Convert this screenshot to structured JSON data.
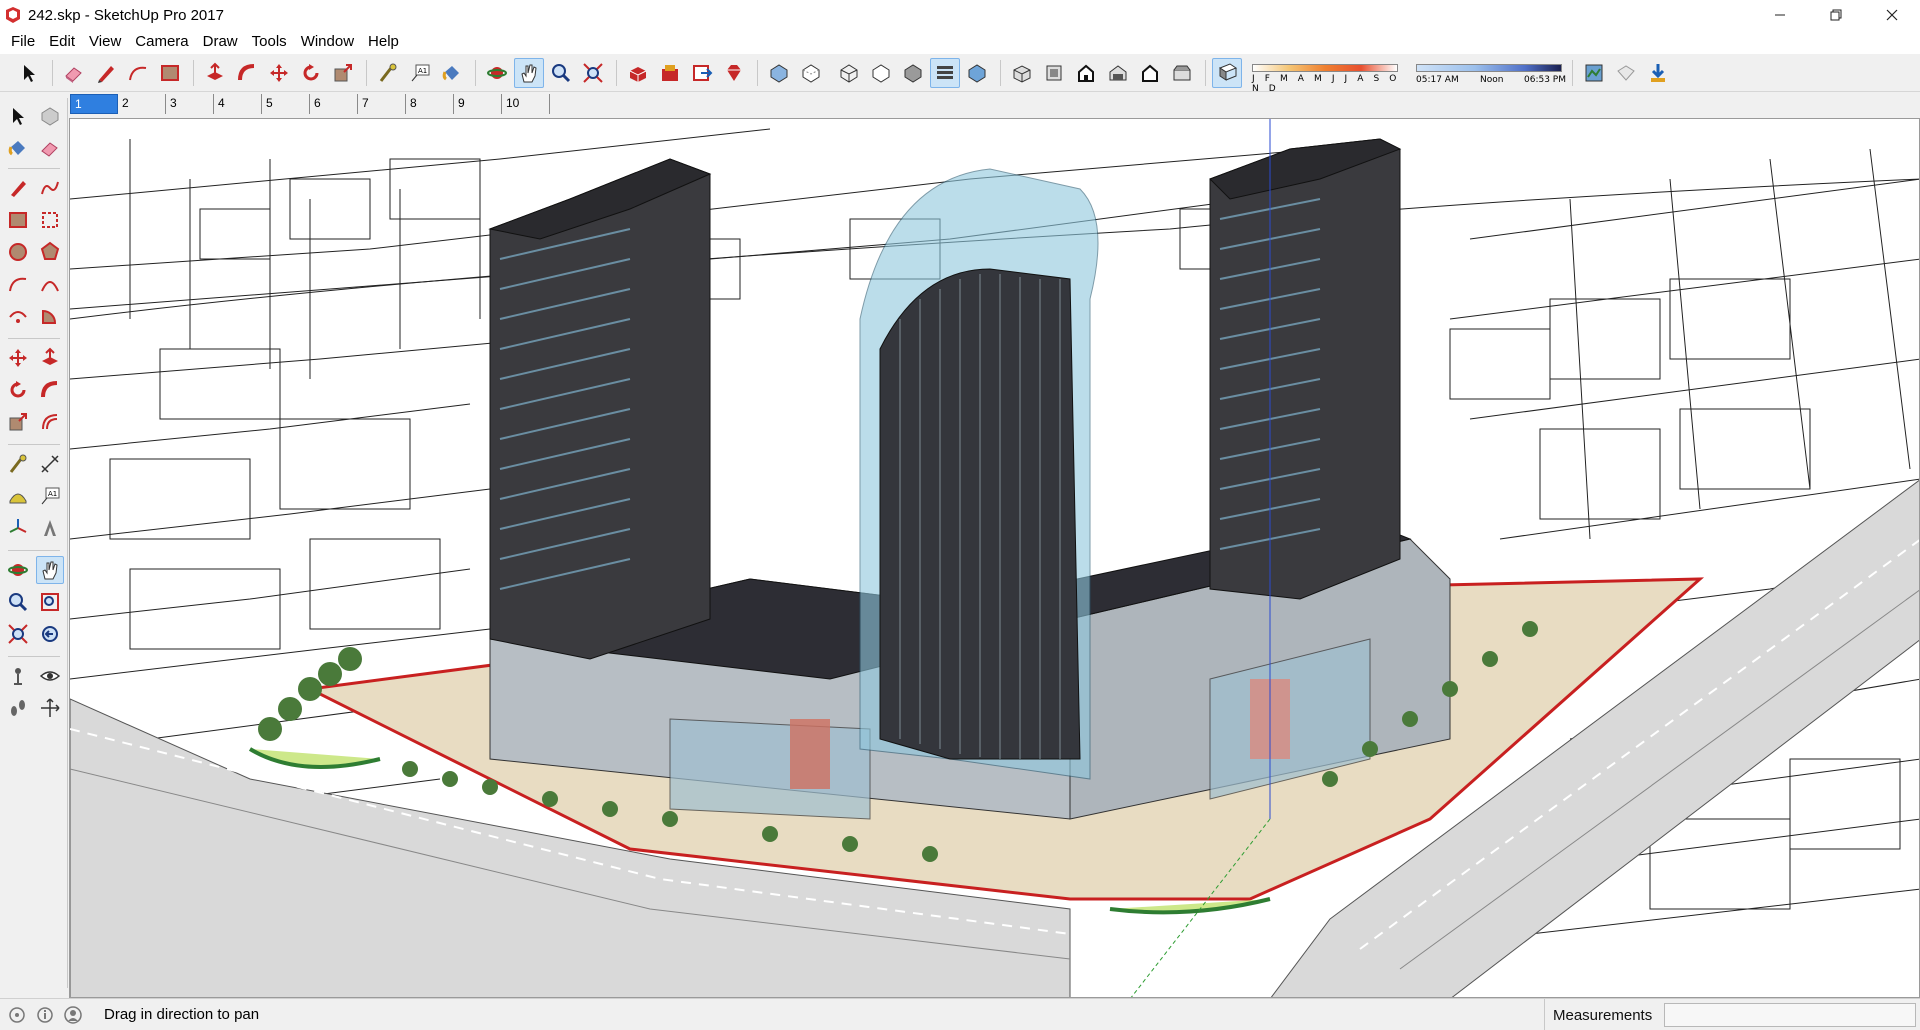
{
  "window": {
    "title": "242.skp - SketchUp Pro 2017",
    "controls": [
      "minimize",
      "maximize",
      "close"
    ]
  },
  "menu": [
    "File",
    "Edit",
    "View",
    "Camera",
    "Draw",
    "Tools",
    "Window",
    "Help"
  ],
  "toolbar": {
    "groups": [
      [
        "select-icon",
        "eraser-icon",
        "pencil-icon",
        "arc-icon",
        "rectangle-icon"
      ],
      [
        "push-pull-icon",
        "follow-me-icon",
        "move-icon",
        "rotate-icon",
        "scale-icon"
      ],
      [
        "tape-measure-icon",
        "text-icon",
        "paint-bucket-icon"
      ],
      [
        "orbit-icon",
        "pan-icon",
        "zoom-icon",
        "zoom-extents-icon"
      ],
      [
        "3d-warehouse-icon",
        "extension-warehouse-icon",
        "send-to-layout-icon",
        "ruby-console-icon"
      ],
      [
        "xray-style-icon",
        "back-edges-style-icon",
        "wireframe-style-icon",
        "hidden-line-style-icon",
        "shaded-style-icon",
        "shaded-textures-style-icon",
        "monochrome-style-icon"
      ],
      [
        "iso-view-icon",
        "top-view-icon",
        "front-view-icon",
        "right-view-icon",
        "back-view-icon",
        "left-view-icon"
      ],
      [
        "shadow-toggle-icon"
      ],
      [
        "layer-manager-icon",
        "tag-icon",
        "import-icon"
      ]
    ],
    "active_tool": "pan-icon",
    "shadow": {
      "months": "J F M A M J J A S O N D",
      "time_start": "05:17 AM",
      "time_mid": "Noon",
      "time_end": "06:53 PM"
    }
  },
  "scenes": [
    "1",
    "2",
    "3",
    "4",
    "5",
    "6",
    "7",
    "8",
    "9",
    "10"
  ],
  "active_scene": "1",
  "left_toolbar": [
    [
      "select-icon",
      "component-icon"
    ],
    [
      "paint-bucket-icon",
      "eraser-icon"
    ],
    [
      "line-icon",
      "freehand-icon"
    ],
    [
      "rectangle-icon",
      "rotated-rectangle-icon"
    ],
    [
      "circle-icon",
      "polygon-icon"
    ],
    [
      "arc-icon",
      "two-point-arc-icon"
    ],
    [
      "three-point-arc-icon",
      "pie-icon"
    ],
    [
      "move-icon",
      "push-pull-icon"
    ],
    [
      "rotate-icon",
      "follow-me-icon"
    ],
    [
      "scale-icon",
      "offset-icon"
    ],
    [
      "tape-measure-icon",
      "dimension-icon"
    ],
    [
      "protractor-icon",
      "text-icon"
    ],
    [
      "axes-icon",
      "3d-text-icon"
    ],
    [
      "orbit-icon",
      "pan-icon"
    ],
    [
      "zoom-icon",
      "zoom-window-icon"
    ],
    [
      "zoom-extents-icon",
      "previous-view-icon"
    ],
    [
      "position-camera-icon",
      "look-around-icon"
    ],
    [
      "walk-icon",
      "section-plane-icon"
    ]
  ],
  "status": {
    "message": "Drag in direction to pan",
    "measurements_label": "Measurements",
    "measurements_value": ""
  },
  "colors": {
    "selection_blue": "#2f7fe0",
    "tower_dark": "#3a3a3e",
    "glass": "#8ec7dd",
    "site_boundary": "#c82020"
  }
}
